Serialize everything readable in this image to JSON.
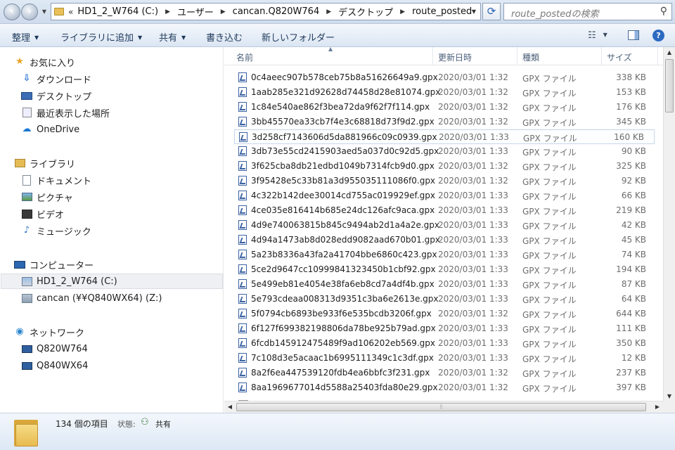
{
  "address_bar": {
    "overflow": "«",
    "crumbs": [
      "HD1_2_W764 (C:)",
      "ユーザー",
      "cancan.Q820W764",
      "デスクトップ",
      "route_posted"
    ],
    "search_placeholder": "route_postedの検索"
  },
  "command_bar": {
    "organize": "整理",
    "include_in_library": "ライブラリに追加",
    "share": "共有",
    "burn": "書き込む",
    "new_folder": "新しいフォルダー"
  },
  "nav": {
    "favorites": "お気に入り",
    "downloads": "ダウンロード",
    "desktop": "デスクトップ",
    "recent": "最近表示した場所",
    "onedrive": "OneDrive",
    "libraries": "ライブラリ",
    "documents": "ドキュメント",
    "pictures": "ピクチャ",
    "videos": "ビデオ",
    "music": "ミュージック",
    "computer": "コンピューター",
    "drive_c": "HD1_2_W764 (C:)",
    "drive_z": "cancan (¥¥Q840WX64) (Z:)",
    "network": "ネットワーク",
    "pc1": "Q820W764",
    "pc2": "Q840WX64"
  },
  "columns": {
    "name": "名前",
    "modified": "更新日時",
    "type": "種類",
    "size": "サイズ"
  },
  "files": [
    {
      "name": "0c4aeec907b578ceb75b8a51626649a9.gpx",
      "date": "2020/03/01 1:32",
      "type": "GPX ファイル",
      "size": "338 KB"
    },
    {
      "name": "1aab285e321d92628d74458d28e81074.gpx",
      "date": "2020/03/01 1:32",
      "type": "GPX ファイル",
      "size": "153 KB"
    },
    {
      "name": "1c84e540ae862f3bea72da9f62f7f114.gpx",
      "date": "2020/03/01 1:32",
      "type": "GPX ファイル",
      "size": "176 KB"
    },
    {
      "name": "3bb45570ea33cb7f4e3c68818d73f9d2.gpx",
      "date": "2020/03/01 1:32",
      "type": "GPX ファイル",
      "size": "345 KB"
    },
    {
      "name": "3d258cf7143606d5da881966c09c0939.gpx",
      "date": "2020/03/01 1:33",
      "type": "GPX ファイル",
      "size": "160 KB"
    },
    {
      "name": "3db73e55cd2415903aed5a037d0c92d5.gpx",
      "date": "2020/03/01 1:33",
      "type": "GPX ファイル",
      "size": "90 KB"
    },
    {
      "name": "3f625cba8db21edbd1049b7314fcb9d0.gpx",
      "date": "2020/03/01 1:32",
      "type": "GPX ファイル",
      "size": "325 KB"
    },
    {
      "name": "3f95428e5c33b81a3d955035111086f0.gpx",
      "date": "2020/03/01 1:32",
      "type": "GPX ファイル",
      "size": "92 KB"
    },
    {
      "name": "4c322b142dee30014cd755ac019929ef.gpx",
      "date": "2020/03/01 1:33",
      "type": "GPX ファイル",
      "size": "66 KB"
    },
    {
      "name": "4ce035e816414b685e24dc126afc9aca.gpx",
      "date": "2020/03/01 1:33",
      "type": "GPX ファイル",
      "size": "219 KB"
    },
    {
      "name": "4d9e740063815b845c9494ab2d1a4a2e.gpx",
      "date": "2020/03/01 1:33",
      "type": "GPX ファイル",
      "size": "42 KB"
    },
    {
      "name": "4d94a1473ab8d028edd9082aad670b01.gpx",
      "date": "2020/03/01 1:33",
      "type": "GPX ファイル",
      "size": "45 KB"
    },
    {
      "name": "5a23b8336a43fa2a41704bbe6860c423.gpx",
      "date": "2020/03/01 1:33",
      "type": "GPX ファイル",
      "size": "74 KB"
    },
    {
      "name": "5ce2d9647cc10999841323450b1cbf92.gpx",
      "date": "2020/03/01 1:33",
      "type": "GPX ファイル",
      "size": "194 KB"
    },
    {
      "name": "5e499eb81e4054e38fa6eb8cd7a4df4b.gpx",
      "date": "2020/03/01 1:33",
      "type": "GPX ファイル",
      "size": "87 KB"
    },
    {
      "name": "5e793cdeaa008313d9351c3ba6e2613e.gpx",
      "date": "2020/03/01 1:33",
      "type": "GPX ファイル",
      "size": "64 KB"
    },
    {
      "name": "5f0794cb6893be933f6e535bcdb3206f.gpx",
      "date": "2020/03/01 1:32",
      "type": "GPX ファイル",
      "size": "644 KB"
    },
    {
      "name": "6f127f699382198806da78be925b79ad.gpx",
      "date": "2020/03/01 1:33",
      "type": "GPX ファイル",
      "size": "111 KB"
    },
    {
      "name": "6fcdb145912475489f9ad106202eb569.gpx",
      "date": "2020/03/01 1:33",
      "type": "GPX ファイル",
      "size": "350 KB"
    },
    {
      "name": "7c108d3e5acaac1b6995111349c1c3df.gpx",
      "date": "2020/03/01 1:33",
      "type": "GPX ファイル",
      "size": "12 KB"
    },
    {
      "name": "8a2f6ea447539120fdb4ea6bbfc3f231.gpx",
      "date": "2020/03/01 1:32",
      "type": "GPX ファイル",
      "size": "237 KB"
    },
    {
      "name": "8aa1969677014d5588a25403fda80e29.gpx",
      "date": "2020/03/01 1:32",
      "type": "GPX ファイル",
      "size": "397 KB"
    }
  ],
  "selected_index": 4,
  "details": {
    "item_count": "134 個の項目",
    "status_label": "状態:",
    "status_value": "共有"
  }
}
